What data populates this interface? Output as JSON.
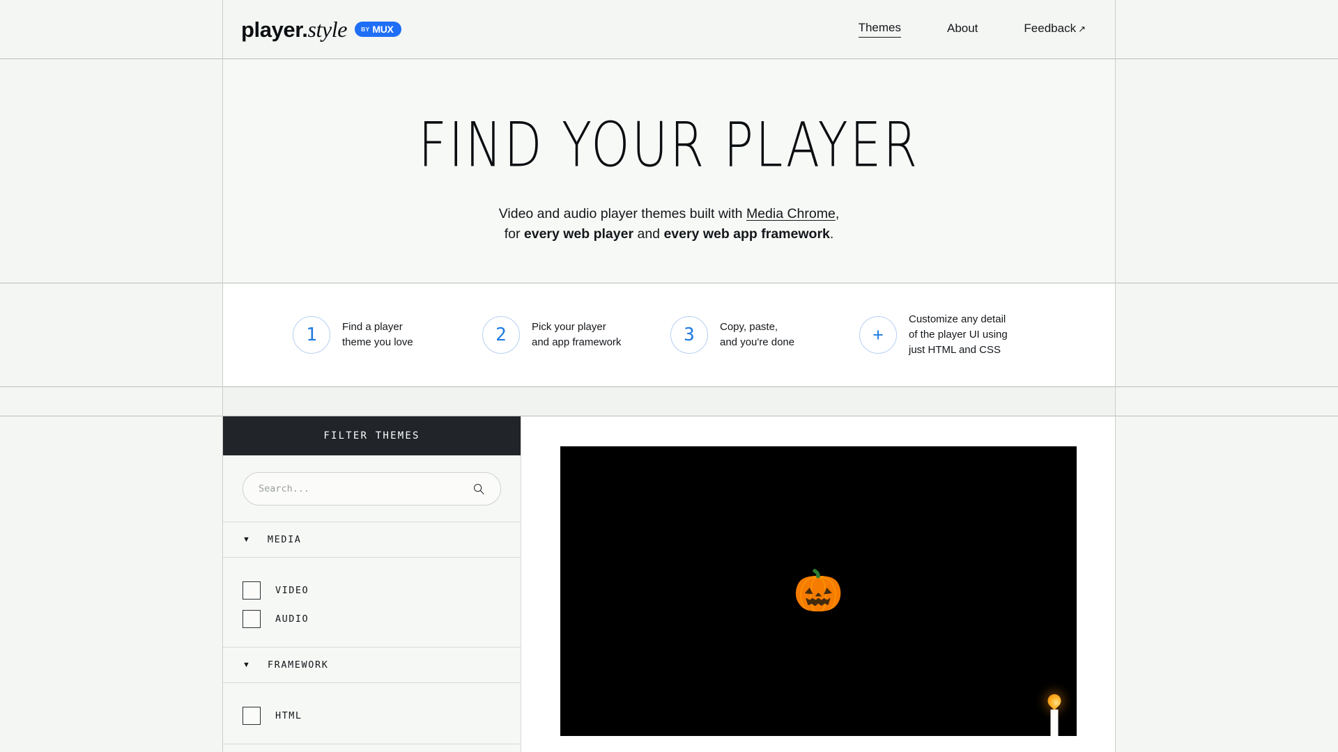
{
  "header": {
    "logo": {
      "word1": "player",
      "dot": ".",
      "word2": "style"
    },
    "badge": {
      "by": "BY",
      "name": "MUX"
    },
    "nav": [
      {
        "label": "Themes",
        "active": true,
        "external": false
      },
      {
        "label": "About",
        "active": false,
        "external": false
      },
      {
        "label": "Feedback",
        "active": false,
        "external": true,
        "arrow": "↗"
      }
    ]
  },
  "hero": {
    "title": "FIND YOUR PLAYER",
    "subtitle_line1_pre": "Video and audio player themes built with ",
    "subtitle_link": "Media Chrome",
    "subtitle_line1_post": ",",
    "subtitle_line2_pre": "for ",
    "subtitle_bold1": "every web player",
    "subtitle_line2_mid": " and ",
    "subtitle_bold2": "every web app framework",
    "subtitle_line2_post": "."
  },
  "steps": [
    {
      "marker": "1",
      "text": "Find a player\ntheme you love"
    },
    {
      "marker": "2",
      "text": "Pick your player\nand app framework"
    },
    {
      "marker": "3",
      "text": "Copy, paste,\nand you're done"
    },
    {
      "marker": "+",
      "text": "Customize any detail\nof the player UI using\njust HTML and CSS"
    }
  ],
  "filters": {
    "header_title": "FILTER THEMES",
    "search": {
      "placeholder": "Search...",
      "value": "",
      "icon": "search-icon"
    },
    "sections": [
      {
        "label": "MEDIA",
        "expanded": true,
        "chevron": "▼",
        "options": [
          {
            "label": "VIDEO",
            "checked": false
          },
          {
            "label": "AUDIO",
            "checked": false
          }
        ]
      },
      {
        "label": "FRAMEWORK",
        "expanded": true,
        "chevron": "▼",
        "options": [
          {
            "label": "HTML",
            "checked": false
          }
        ]
      }
    ]
  },
  "preview": {
    "theme_art": "halloween-pumpkin",
    "pumpkin_glyph": "🎃",
    "background_color": "#000000",
    "candle": {
      "flame_color": "#ffb32b",
      "wax_color": "#fdfdfb"
    }
  },
  "colors": {
    "page_background": "#f4f6f3",
    "content_background": "#ffffff",
    "accent_blue": "#1f7ae0",
    "brand_blue": "#1f6ef6",
    "dark_bar": "#212428",
    "grid_line": "#c9cdc8"
  }
}
